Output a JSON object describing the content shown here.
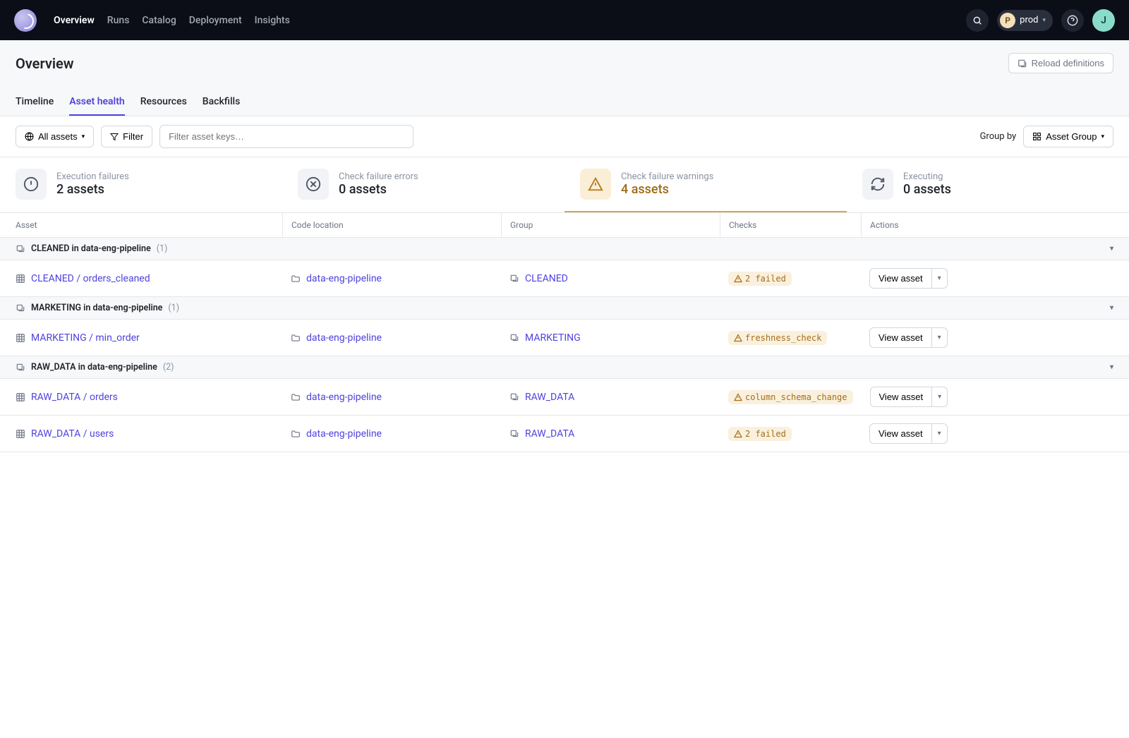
{
  "nav": {
    "links": [
      "Overview",
      "Runs",
      "Catalog",
      "Deployment",
      "Insights"
    ],
    "active": "Overview",
    "env_letter": "P",
    "env_label": "prod",
    "avatar_letter": "J"
  },
  "page": {
    "title": "Overview",
    "reload_label": "Reload definitions",
    "tabs": [
      "Timeline",
      "Asset health",
      "Resources",
      "Backfills"
    ],
    "active_tab": "Asset health"
  },
  "toolbar": {
    "all_assets_label": "All assets",
    "filter_label": "Filter",
    "search_placeholder": "Filter asset keys…",
    "group_by_label": "Group by",
    "group_by_value": "Asset Group"
  },
  "summary": [
    {
      "label": "Execution failures",
      "value": "2 assets",
      "icon": "alert"
    },
    {
      "label": "Check failure errors",
      "value": "0 assets",
      "icon": "error"
    },
    {
      "label": "Check failure warnings",
      "value": "4 assets",
      "icon": "warning",
      "active": true
    },
    {
      "label": "Executing",
      "value": "0 assets",
      "icon": "refresh"
    }
  ],
  "table": {
    "columns": {
      "asset": "Asset",
      "location": "Code location",
      "group": "Group",
      "checks": "Checks",
      "actions": "Actions"
    },
    "view_label": "View asset",
    "groups": [
      {
        "header": "CLEANED in data-eng-pipeline",
        "count": "(1)",
        "rows": [
          {
            "asset": "CLEANED / orders_cleaned",
            "location": "data-eng-pipeline",
            "group": "CLEANED",
            "check": "2 failed"
          }
        ]
      },
      {
        "header": "MARKETING in data-eng-pipeline",
        "count": "(1)",
        "rows": [
          {
            "asset": "MARKETING / min_order",
            "location": "data-eng-pipeline",
            "group": "MARKETING",
            "check": "freshness_check"
          }
        ]
      },
      {
        "header": "RAW_DATA in data-eng-pipeline",
        "count": "(2)",
        "rows": [
          {
            "asset": "RAW_DATA / orders",
            "location": "data-eng-pipeline",
            "group": "RAW_DATA",
            "check": "column_schema_change"
          },
          {
            "asset": "RAW_DATA / users",
            "location": "data-eng-pipeline",
            "group": "RAW_DATA",
            "check": "2 failed"
          }
        ]
      }
    ]
  }
}
